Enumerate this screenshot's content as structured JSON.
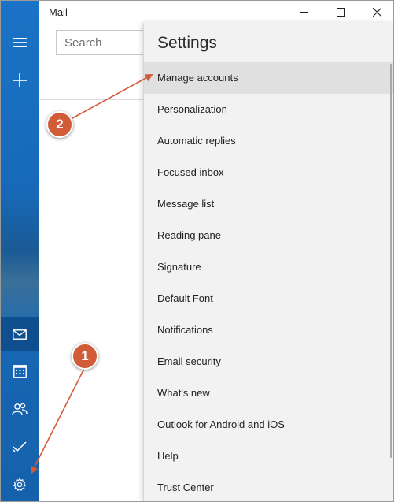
{
  "app": {
    "title": "Mail"
  },
  "window_controls": {
    "minimize_icon": "minimize-icon",
    "maximize_icon": "maximize-icon",
    "close_icon": "close-icon"
  },
  "rail": {
    "items": [
      {
        "name": "hamburger-menu-icon"
      },
      {
        "name": "new-mail-plus-icon"
      },
      {
        "name": "mail-icon"
      },
      {
        "name": "calendar-icon"
      },
      {
        "name": "people-icon"
      },
      {
        "name": "todo-check-icon"
      },
      {
        "name": "gear-icon"
      }
    ]
  },
  "search": {
    "placeholder": "Search"
  },
  "settings": {
    "title": "Settings",
    "items": [
      {
        "label": "Manage accounts"
      },
      {
        "label": "Personalization"
      },
      {
        "label": "Automatic replies"
      },
      {
        "label": "Focused inbox"
      },
      {
        "label": "Message list"
      },
      {
        "label": "Reading pane"
      },
      {
        "label": "Signature"
      },
      {
        "label": "Default Font"
      },
      {
        "label": "Notifications"
      },
      {
        "label": "Email security"
      },
      {
        "label": "What's new"
      },
      {
        "label": "Outlook for Android and iOS"
      },
      {
        "label": "Help"
      },
      {
        "label": "Trust Center"
      }
    ]
  },
  "annotations": {
    "marker1": "1",
    "marker2": "2",
    "color": "#d25b38"
  },
  "colors": {
    "rail": "#1766b3",
    "settings_bg": "#f2f2f2"
  }
}
